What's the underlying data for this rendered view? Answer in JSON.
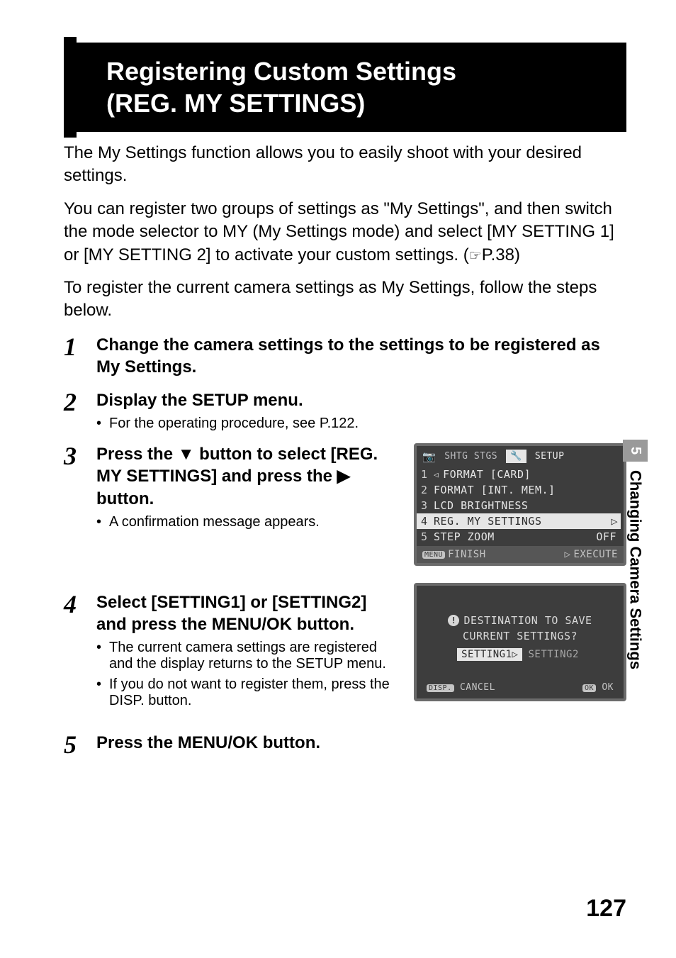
{
  "title_line1": "Registering Custom Settings",
  "title_line2": "(REG. MY SETTINGS)",
  "intro_p1_a": "The My Settings function allows you to easily shoot with your desired settings.",
  "intro_p1_b": "You can register two groups of settings as \"My Settings\", and then switch the mode selector to MY (My Settings mode) and select [MY SETTING 1] or [MY SETTING 2] to activate your custom settings. (",
  "intro_page_ref": "P.38)",
  "intro_p2": "To register the current camera settings as My Settings, follow the steps below.",
  "step1": {
    "num": "1",
    "title": "Change the camera settings to the settings to be registered as My Settings."
  },
  "step2": {
    "num": "2",
    "title": "Display the SETUP menu.",
    "sub": "For the operating procedure, see P.122."
  },
  "step3": {
    "num": "3",
    "title_a": "Press the ",
    "title_b": " button to select [REG. MY SETTINGS] and press the ",
    "title_c": " button.",
    "sub": "A confirmation message appears."
  },
  "step4": {
    "num": "4",
    "title": "Select [SETTING1] or [SETTING2] and press the MENU/OK button.",
    "sub1": "The current camera settings are registered and the display returns to the SETUP menu.",
    "sub2": "If you do not want to register them, press the DISP. button."
  },
  "step5": {
    "num": "5",
    "title": "Press the MENU/OK button."
  },
  "screen1": {
    "tab1": "SHTG STGS",
    "tab2": "SETUP",
    "rows": [
      {
        "n": "1",
        "label": "FORMAT [CARD]",
        "val": ""
      },
      {
        "n": "2",
        "label": "FORMAT [INT. MEM.]",
        "val": ""
      },
      {
        "n": "3",
        "label": "LCD BRIGHTNESS",
        "val": ""
      },
      {
        "n": "4",
        "label": "REG. MY SETTINGS",
        "val": "",
        "selected": true
      },
      {
        "n": "5",
        "label": "STEP ZOOM",
        "val": "OFF"
      }
    ],
    "footer_left": "FINISH",
    "footer_right": "EXECUTE"
  },
  "screen2": {
    "msg1": "DESTINATION TO SAVE",
    "msg2": "CURRENT SETTINGS?",
    "opt1": "SETTING1",
    "opt2": "SETTING2",
    "footer_left": "CANCEL",
    "footer_right": "OK"
  },
  "side": {
    "num": "5",
    "label": "Changing Camera Settings"
  },
  "page_number": "127"
}
